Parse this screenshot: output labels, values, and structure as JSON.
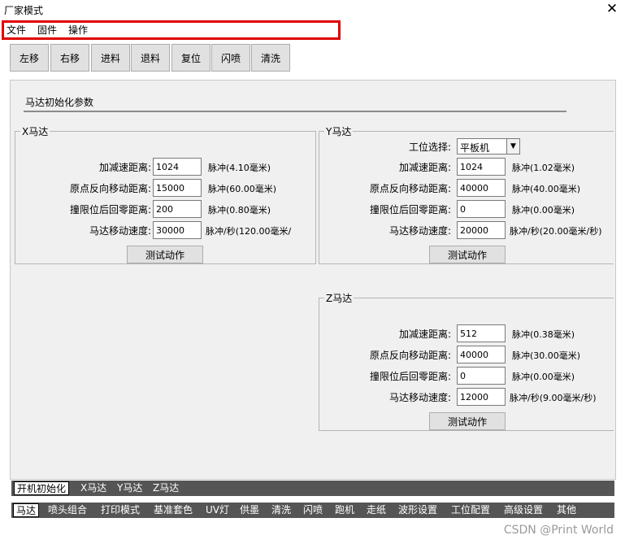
{
  "window": {
    "title": "厂家模式",
    "close_glyph": "✕"
  },
  "menu": {
    "items": [
      "文件",
      "固件",
      "操作"
    ]
  },
  "toolbar": {
    "buttons": [
      "左移",
      "右移",
      "进料",
      "退料",
      "复位",
      "闪喷",
      "清洗"
    ]
  },
  "panel": {
    "title": "马达初始化参数",
    "x_motor": {
      "title": "X马达",
      "accel_label": "加减速距离:",
      "accel_value": "1024",
      "accel_unit": "脉冲(4.10毫米)",
      "origin_label": "原点反向移动距离:",
      "origin_value": "15000",
      "origin_unit": "脉冲(60.00毫米)",
      "limit_label": "撞限位后回零距离:",
      "limit_value": "200",
      "limit_unit": "脉冲(0.80毫米)",
      "speed_label": "马达移动速度:",
      "speed_value": "30000",
      "speed_unit": "脉冲/秒(120.00毫米/",
      "test_button": "测试动作"
    },
    "y_motor": {
      "title": "Y马达",
      "station_label": "工位选择:",
      "station_value": "平板机",
      "accel_label": "加减速距离:",
      "accel_value": "1024",
      "accel_unit": "脉冲(1.02毫米)",
      "origin_label": "原点反向移动距离:",
      "origin_value": "40000",
      "origin_unit": "脉冲(40.00毫米)",
      "limit_label": "撞限位后回零距离:",
      "limit_value": "0",
      "limit_unit": "脉冲(0.00毫米)",
      "speed_label": "马达移动速度:",
      "speed_value": "20000",
      "speed_unit": "脉冲/秒(20.00毫米/秒)",
      "test_button": "测试动作"
    },
    "z_motor": {
      "title": "Z马达",
      "accel_label": "加减速距离:",
      "accel_value": "512",
      "accel_unit": "脉冲(0.38毫米)",
      "origin_label": "原点反向移动距离:",
      "origin_value": "40000",
      "origin_unit": "脉冲(30.00毫米)",
      "limit_label": "撞限位后回零距离:",
      "limit_value": "0",
      "limit_unit": "脉冲(0.00毫米)",
      "speed_label": "马达移动速度:",
      "speed_value": "12000",
      "speed_unit": "脉冲/秒(9.00毫米/秒)",
      "test_button": "测试动作"
    }
  },
  "subtabs": [
    "开机初始化",
    "X马达",
    "Y马达",
    "Z马达"
  ],
  "maintabs": [
    "马达",
    "喷头组合",
    "打印模式",
    "基准套色",
    "UV灯",
    "供墨",
    "清洗",
    "闪喷",
    "跑机",
    "走纸",
    "波形设置",
    "工位配置",
    "高级设置",
    "其他"
  ],
  "watermark": "CSDN @Print World"
}
